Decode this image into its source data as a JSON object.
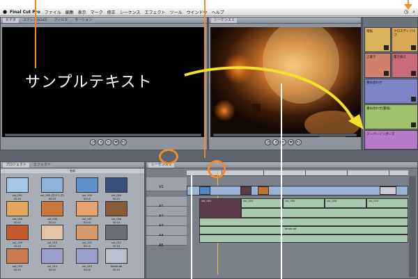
{
  "menubar": {
    "app_name": "Final Cut Pro",
    "items": [
      "ファイル",
      "編集",
      "表示",
      "マーク",
      "修正",
      "シーケンス",
      "エフェクト",
      "ツール",
      "ウインドウ",
      "ヘルプ"
    ]
  },
  "viewer": {
    "tabs": [
      "ビデオ",
      "ステレオ(a1a2)",
      "フィルタ",
      "モーション"
    ]
  },
  "canvas": {
    "tabs": [
      "シーケンス 1"
    ]
  },
  "effects": {
    "items": [
      {
        "label": "暗転",
        "color": "#d9b25a"
      },
      {
        "label": "クロスディゾルブ",
        "color": "#d9a955"
      },
      {
        "label": "上書き",
        "color": "#d1806b"
      },
      {
        "label": "置き換え",
        "color": "#c96b7a"
      },
      {
        "label": "重ね合わせ",
        "color": "#7f83c8"
      },
      {
        "label": "",
        "color": "#7a86c4"
      },
      {
        "label": "重ね合わせ(置換)",
        "color": "#9fc26b"
      },
      {
        "label": "スーパーインポーズ",
        "color": "#b77ac9"
      }
    ]
  },
  "browser": {
    "tabs": [
      "プロジェクト",
      "エフェクト"
    ],
    "header": "名前",
    "clips": [
      {
        "name": "cut_001",
        "sub": "00:10",
        "color": "#a6c6e6"
      },
      {
        "name": "cut_002 (ステレオ)",
        "sub": "00:10",
        "color": "#8fb3d8"
      },
      {
        "name": "cut_003",
        "sub": "00:10",
        "color": "#5f8fc7"
      },
      {
        "name": "cut_004",
        "sub": "00:10",
        "color": "#39507a"
      },
      {
        "name": "cut_005",
        "sub": "00:10",
        "color": "#e1a85a"
      },
      {
        "name": "cut_006",
        "sub": "00:10",
        "color": "#c9773a"
      },
      {
        "name": "cut_007",
        "sub": "00:10",
        "color": "#e6a36b"
      },
      {
        "name": "cut_008",
        "sub": "00:10",
        "color": "#8a5e38"
      },
      {
        "name": "cut_009",
        "sub": "00:10",
        "color": "#c45b2d"
      },
      {
        "name": "cut_010",
        "sub": "00:10",
        "color": "#e2c2a8"
      },
      {
        "name": "cut_011",
        "sub": "00:10",
        "color": "#d89a6a"
      },
      {
        "name": "cut_012",
        "sub": "00:10",
        "color": "#6b6f7a"
      },
      {
        "name": "cut_013",
        "sub": "00:10",
        "color": "#c87a52"
      },
      {
        "name": "cut_014",
        "sub": "00:10",
        "color": "#9aa0c8"
      },
      {
        "name": "cut_015",
        "sub": "00:10",
        "color": "#9aa0c8"
      },
      {
        "name": "Movie.aif",
        "sub": "00:10",
        "color": "#b8bfd0"
      }
    ]
  },
  "timeline": {
    "tabs": [
      "シーケンス 1"
    ],
    "tracks": [
      "V1",
      "A1",
      "A2",
      "A3",
      "A4",
      "A5"
    ],
    "clip_labels": [
      "cut_001",
      "cut_003",
      "cut_005",
      "cut_008",
      "cut_010",
      "Movie.aif"
    ]
  },
  "annotation": {
    "caption": "サンプルテキスト",
    "ring_color": "#f28c28",
    "arrow_color": "#f2e12a"
  }
}
